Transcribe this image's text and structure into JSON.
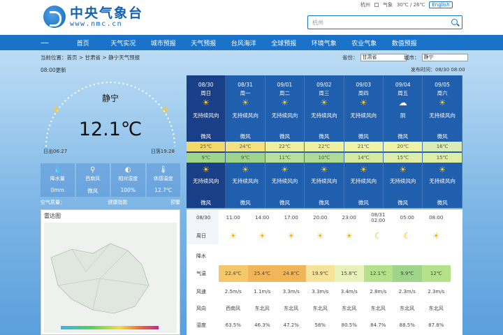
{
  "header": {
    "logo_cn": "中央气象台",
    "logo_en": "www.nmc.cn",
    "toplinks": [
      "杭州",
      "气象",
      "30℃ / 26℃"
    ],
    "english": "English",
    "search_placeholder": "杭州"
  },
  "nav": {
    "items": [
      "首页",
      "天气实况",
      "城市预报",
      "天气预报",
      "台风海洋",
      "全球预报",
      "环境气象",
      "农业气象",
      "数值预报"
    ]
  },
  "breadcrumb": "当前位置：首页 > 甘肃省 > 静宁天气预报",
  "selectors": {
    "province_label": "省份：",
    "province": "甘肃省",
    "city_label": "城市：",
    "city": "静宁"
  },
  "publish_time": "发布时间：08/30 08:00",
  "update_line": "08:00更新",
  "current": {
    "city": "静宁",
    "temp": "12.1℃",
    "sunrise": "日出06:27",
    "sunset": "日落19:28"
  },
  "stats": [
    {
      "label": "降水量",
      "value": "0mm",
      "icon": "droplet-icon"
    },
    {
      "label": "西南风",
      "value": "微风",
      "icon": "wind-icon"
    },
    {
      "label": "相对湿度",
      "value": "100%",
      "icon": "humidity-icon"
    },
    {
      "label": "体感温度",
      "value": "12.7℃",
      "icon": "thermometer-icon"
    }
  ],
  "aqi": {
    "label": "空气质量：",
    "health": "健康指数",
    "alert": "预警"
  },
  "radar": {
    "title": "雷达图"
  },
  "forecast": [
    {
      "date": "08/30",
      "week": "周日",
      "day_desc": "无持续风向",
      "day_wind": "微风",
      "hi": "25℃",
      "lo": "9℃",
      "night_desc": "无持续风向",
      "night_wind": "微风",
      "icon": "sun-icon",
      "hi_color": "#f3d86a",
      "lo_color": "#9fd58a"
    },
    {
      "date": "08/31",
      "week": "周一",
      "day_desc": "无持续风向",
      "day_wind": "微风",
      "hi": "24℃",
      "lo": "9℃",
      "night_desc": "无持续风向",
      "night_wind": "微风",
      "icon": "sun-icon",
      "hi_color": "#f3e27f",
      "lo_color": "#9fd58a"
    },
    {
      "date": "09/01",
      "week": "周二",
      "day_desc": "无持续风向",
      "day_wind": "微风",
      "hi": "22℃",
      "lo": "11℃",
      "night_desc": "无持续风向",
      "night_wind": "微风",
      "icon": "sun-icon",
      "hi_color": "#eef0a0",
      "lo_color": "#b7e09a"
    },
    {
      "date": "09/02",
      "week": "周三",
      "day_desc": "无持续风向",
      "day_wind": "微风",
      "hi": "22℃",
      "lo": "10℃",
      "night_desc": "无持续风向",
      "night_wind": "微风",
      "icon": "sun-icon",
      "hi_color": "#eef0a0",
      "lo_color": "#aedb95"
    },
    {
      "date": "09/03",
      "week": "周四",
      "day_desc": "无持续风向",
      "day_wind": "微风",
      "hi": "21℃",
      "lo": "14℃",
      "night_desc": "无持续风向",
      "night_wind": "微风",
      "icon": "sun-icon",
      "hi_color": "#eef3a8",
      "lo_color": "#d4ea9e"
    },
    {
      "date": "09/04",
      "week": "周五",
      "day_desc": "阴",
      "day_wind": "微风",
      "hi": "20℃",
      "lo": "15℃",
      "night_desc": "无持续风向",
      "night_wind": "微风",
      "icon": "cloud-icon",
      "hi_color": "#eef3a8",
      "lo_color": "#dfeea6"
    },
    {
      "date": "09/05",
      "week": "周六",
      "day_desc": "无持续风向",
      "day_wind": "微风",
      "hi": "16℃",
      "lo": "15℃",
      "night_desc": "无持续风向",
      "night_wind": "微风",
      "icon": "sun-icon",
      "hi_color": "#d8ecb4",
      "lo_color": "#dfeea6"
    }
  ],
  "hourly": {
    "date": "08/30",
    "weekday": "周日",
    "times": [
      "11:00",
      "14:00",
      "17:00",
      "20:00",
      "23:00",
      "08/31 02:00",
      "05:00",
      "08:00"
    ],
    "icons": [
      "sun-icon",
      "sun-icon",
      "sun-icon",
      "sun-icon",
      "sun-icon",
      "moon-icon",
      "moon-icon",
      "sun-icon"
    ],
    "rain_label": "降水",
    "temp_label": "气温",
    "wind_label": "风速",
    "wdir_label": "风向",
    "hum_label": "湿度",
    "temps": [
      "22.4℃",
      "25.4℃",
      "24.8℃",
      "19.9℃",
      "15.8℃",
      "12.1℃",
      "9.9℃",
      "12℃"
    ],
    "temp_colors": [
      "#f5c96b",
      "#f2b65a",
      "#f2b65a",
      "#f7e39a",
      "#eaf2bc",
      "#b5e08c",
      "#9fd58a",
      "#b5e08c"
    ],
    "winds": [
      "2.5m/s",
      "1.1m/s",
      "3.3m/s",
      "3.3m/s",
      "3.4m/s",
      "2.8m/s",
      "2.3m/s",
      "2.3m/s"
    ],
    "wdirs": [
      "西南风",
      "东北风",
      "东北风",
      "东北风",
      "东北风",
      "东北风",
      "东北风",
      "东北风"
    ],
    "hums": [
      "63.5%",
      "46.3%",
      "47.2%",
      "58%",
      "80.5%",
      "84.7%",
      "88.5%",
      "87.8%"
    ]
  }
}
